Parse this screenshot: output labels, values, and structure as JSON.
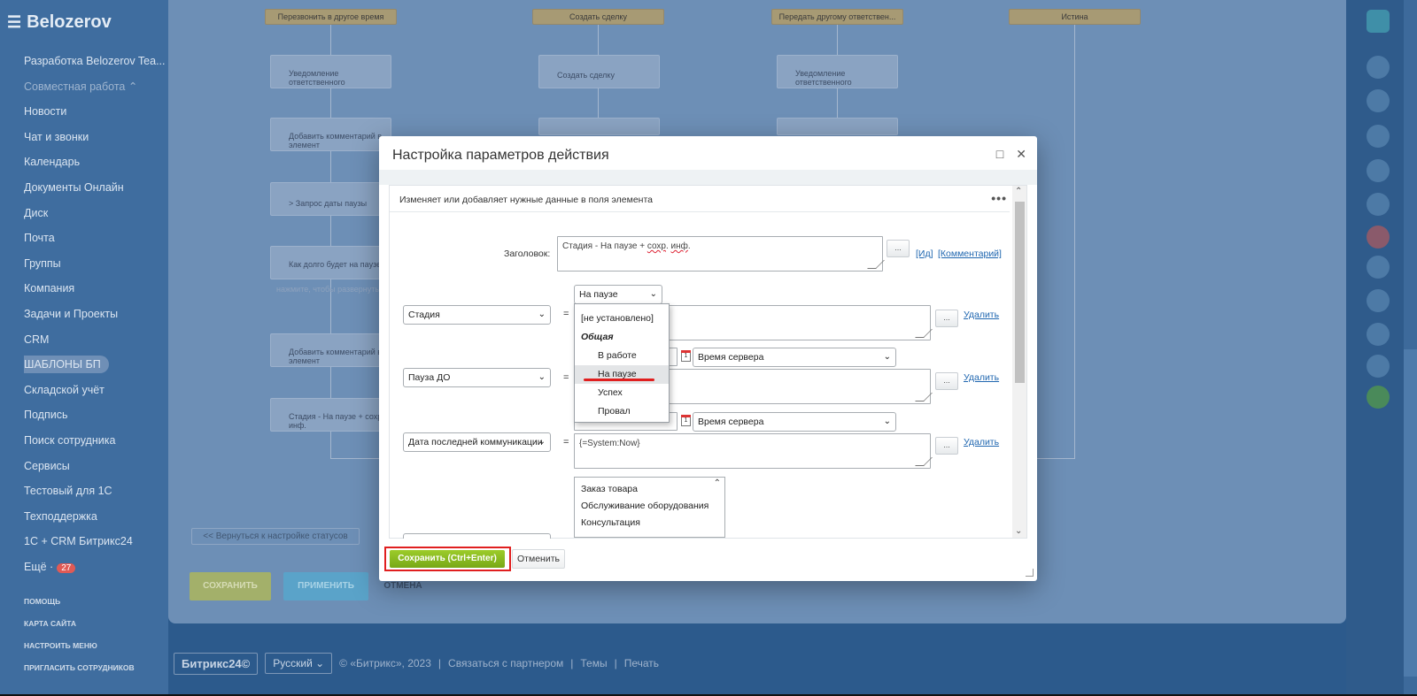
{
  "sidebar": {
    "logo": "Belozerov",
    "items": [
      {
        "label": "Разработка Belozerov Tea..."
      },
      {
        "label": "Совместная работа ⌃"
      },
      {
        "label": "Новости"
      },
      {
        "label": "Чат и звонки"
      },
      {
        "label": "Календарь"
      },
      {
        "label": "Документы Онлайн"
      },
      {
        "label": "Диск"
      },
      {
        "label": "Почта"
      },
      {
        "label": "Группы"
      },
      {
        "label": "Компания"
      },
      {
        "label": "Задачи и Проекты"
      },
      {
        "label": "CRM"
      },
      {
        "label": "ШАБЛОНЫ БП"
      },
      {
        "label": "Складской учёт"
      },
      {
        "label": "Подпись"
      },
      {
        "label": "Поиск сотрудника"
      },
      {
        "label": "Сервисы"
      },
      {
        "label": "Тестовый для 1С"
      },
      {
        "label": "Техподдержка"
      },
      {
        "label": "1С + CRM Битрикс24"
      },
      {
        "label": "Ещё ·",
        "badge": "27"
      }
    ],
    "footer_links": [
      "ПОМОЩЬ",
      "КАРТА САЙТА",
      "НАСТРОИТЬ МЕНЮ",
      "ПРИГЛАСИТЬ СОТРУДНИКОВ"
    ]
  },
  "flow": {
    "headers": [
      "Перезвонить в другое время",
      "Создать сделку",
      "Передать другому ответствен...",
      "Истина"
    ],
    "cards": [
      "Уведомление ответственного",
      "Добавить комментарий в элемент",
      "> Запрос даты паузы",
      "Как долго будет на паузе?",
      "Добавить комментарий в элемент",
      "Стадия - На паузе + сохр. инф.",
      "Создать сделку",
      "Уведомление ответственного"
    ],
    "hint": "нажмите, чтобы развернуть",
    "back_button": "<< Вернуться к настройке статусов",
    "save": "СОХРАНИТЬ",
    "apply": "ПРИМЕНИТЬ",
    "cancel": "ОТМЕНА"
  },
  "footer": {
    "logo": "Битрикс24©",
    "lang": "Русский ⌄",
    "copyright": "© «Битрикс», 2023",
    "partner": "Связаться с партнером",
    "themes": "Темы",
    "print": "Печать"
  },
  "modal": {
    "title": "Настройка параметров действия",
    "description": "Изменяет или добавляет нужные данные в поля элемента",
    "title_label": "Заголовок:",
    "title_value_plain": "Стадия - На паузе + ",
    "title_value_spell1": "сохр",
    "title_value_mid": ". ",
    "title_value_spell2": "инф",
    "title_value_end": ".",
    "dots_button": "...",
    "link_id": "[Ид]",
    "link_comment": "[Комментарий]",
    "rows": [
      {
        "field": "Стадия",
        "value": ""
      },
      {
        "field": "Пауза ДО",
        "value": ""
      },
      {
        "field": "Дата последней коммуникации",
        "value": "{=System:Now}"
      }
    ],
    "equals": "=",
    "delete_link": "Удалить",
    "server_time": "Время сервера",
    "calendar_num": "1",
    "stage_select": "На паузе",
    "dropdown": {
      "options": [
        {
          "label": "[не установлено]",
          "type": "plain"
        },
        {
          "label": "Общая",
          "type": "group"
        },
        {
          "label": "В работе",
          "type": "indent"
        },
        {
          "label": "На паузе",
          "type": "indent-active"
        },
        {
          "label": "Успех",
          "type": "indent"
        },
        {
          "label": "Провал",
          "type": "indent"
        }
      ]
    },
    "listbox": [
      "Заказ товара",
      "Обслуживание оборудования",
      "Консультация"
    ],
    "save_button": "Сохранить (Ctrl+Enter)",
    "cancel_button": "Отменить"
  }
}
